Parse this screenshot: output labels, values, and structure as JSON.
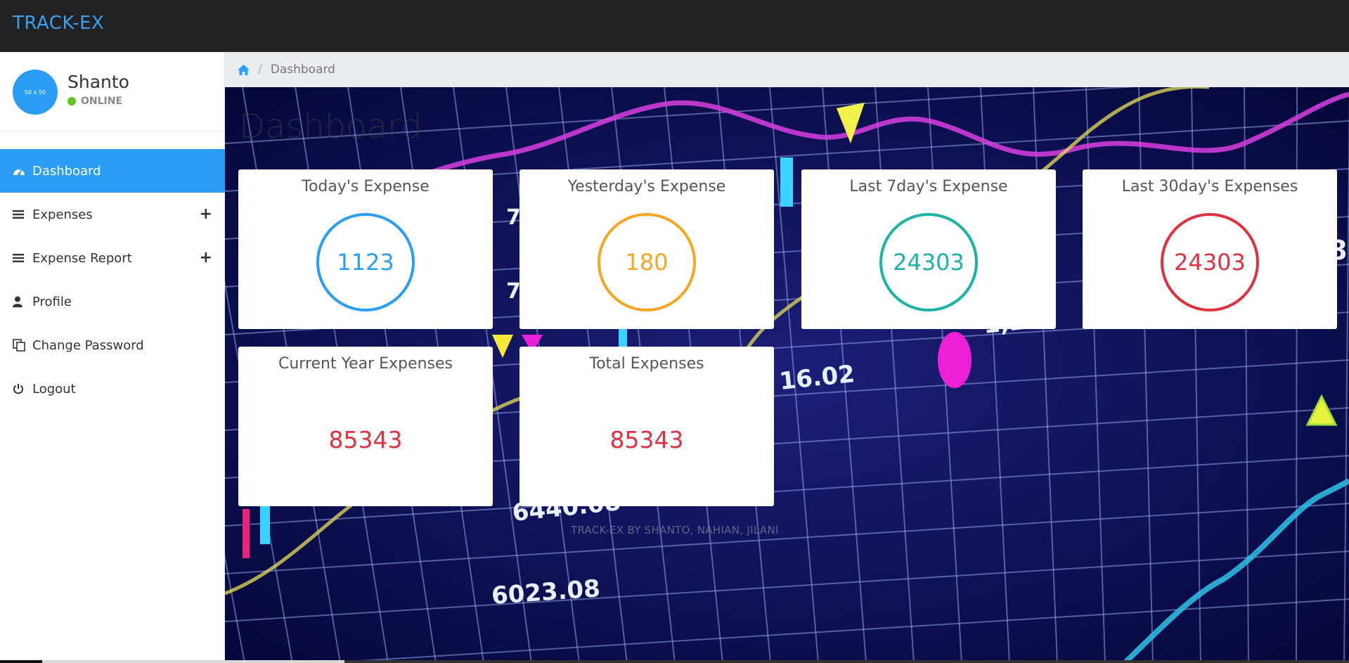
{
  "app": {
    "brand": "TRACK-EX"
  },
  "user": {
    "avatar_text": "50 x 50",
    "name": "Shanto",
    "status": "ONLINE",
    "status_color": "#5fc71f"
  },
  "sidebar": {
    "items": [
      {
        "label": "Dashboard",
        "icon": "dashboard-icon",
        "active": true,
        "expandable": false
      },
      {
        "label": "Expenses",
        "icon": "list-icon",
        "active": false,
        "expandable": true
      },
      {
        "label": "Expense Report",
        "icon": "list-icon",
        "active": false,
        "expandable": true
      },
      {
        "label": "Profile",
        "icon": "user-icon",
        "active": false,
        "expandable": false
      },
      {
        "label": "Change Password",
        "icon": "copy-icon",
        "active": false,
        "expandable": false
      },
      {
        "label": "Logout",
        "icon": "power-icon",
        "active": false,
        "expandable": false
      }
    ],
    "expand_glyph": "+"
  },
  "breadcrumb": {
    "home_icon": "home-icon",
    "separator": "/",
    "current": "Dashboard"
  },
  "main": {
    "title": "Dashboard",
    "footer": "TRACK-EX BY SHANTO, NAHIAN, JILANI"
  },
  "cards": [
    {
      "title": "Today's Expense",
      "value": "1123",
      "color": "#2a9df4"
    },
    {
      "title": "Yesterday's Expense",
      "value": "180",
      "color": "#f5a623"
    },
    {
      "title": "Last 7day's Expense",
      "value": "24303",
      "color": "#1ab3a6"
    },
    {
      "title": "Last 30day's Expenses",
      "value": "24303",
      "color": "#e0313f"
    },
    {
      "title": "Current Year Expenses",
      "value": "85343",
      "color": "#e0313f"
    },
    {
      "title": "Total Expenses",
      "value": "85343",
      "color": "#e0313f"
    }
  ],
  "theme": {
    "accent": "#2a9df4",
    "topbar": "#222222",
    "breadcrumb_bg": "#e9edf2"
  }
}
